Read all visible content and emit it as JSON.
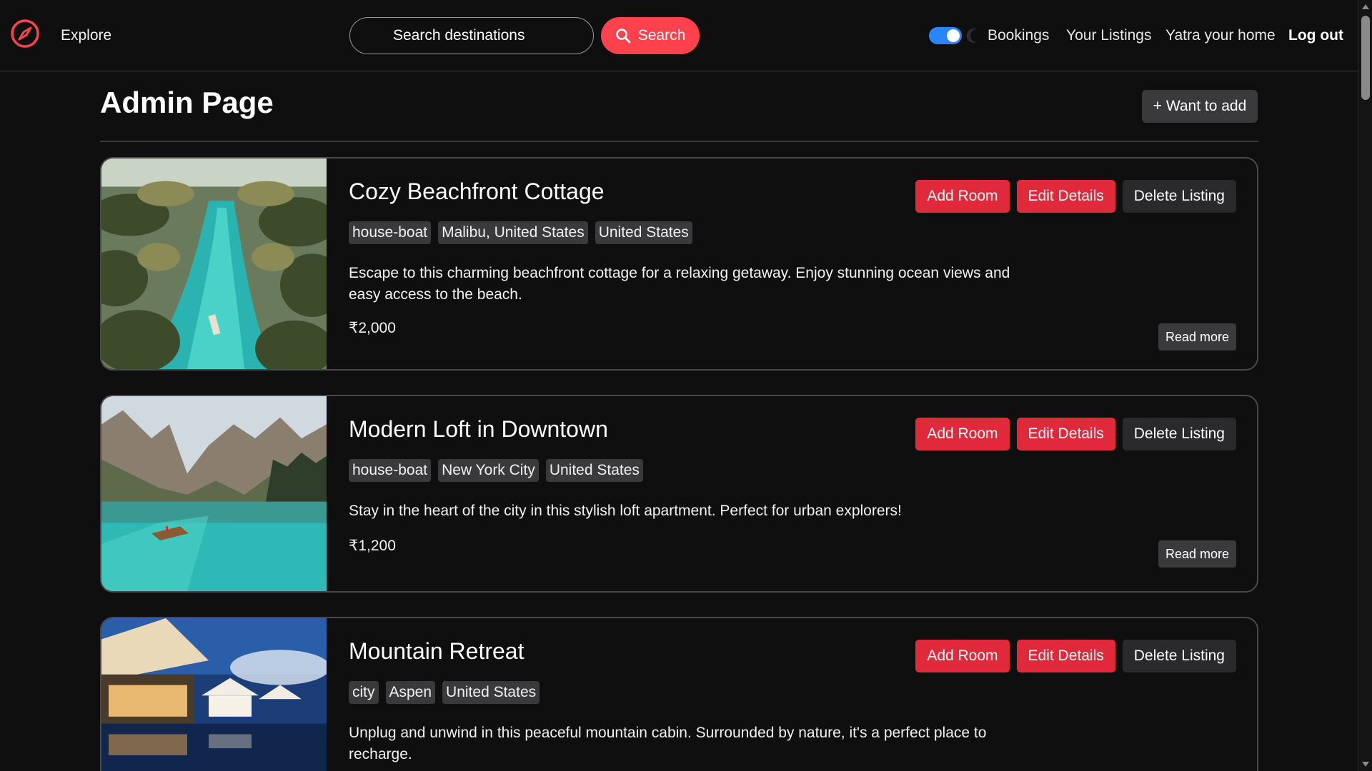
{
  "nav": {
    "explore": "Explore",
    "search_placeholder": "Search destinations",
    "search_button": "Search",
    "links": [
      "Bookings",
      "Your Listings",
      "Yatra your home",
      "Log out"
    ],
    "accent_color": "#fe424d",
    "toggle_on": true
  },
  "page": {
    "title": "Admin Page",
    "add_button": "+ Want to add"
  },
  "actions": {
    "add_room": "Add Room",
    "edit_details": "Edit Details",
    "delete_listing": "Delete Listing",
    "read_more": "Read more"
  },
  "listings": [
    {
      "title": "Cozy Beachfront Cottage",
      "tags": [
        "house-boat",
        "Malibu, United States",
        "United States"
      ],
      "description": "Escape to this charming beachfront cottage for a relaxing getaway. Enjoy stunning ocean views and easy access to the beach.",
      "price": "₹2,000",
      "image": "tropical-river-palms"
    },
    {
      "title": "Modern Loft in Downtown",
      "tags": [
        "house-boat",
        "New York City",
        "United States"
      ],
      "description": "Stay in the heart of the city in this stylish loft apartment. Perfect for urban explorers!",
      "price": "₹1,200",
      "image": "mountain-lake-boat"
    },
    {
      "title": "Mountain Retreat",
      "tags": [
        "city",
        "Aspen",
        "United States"
      ],
      "description": "Unplug and unwind in this peaceful mountain cabin. Surrounded by nature, it's a perfect place to recharge.",
      "price": "",
      "image": "resort-pool-evening"
    }
  ]
}
